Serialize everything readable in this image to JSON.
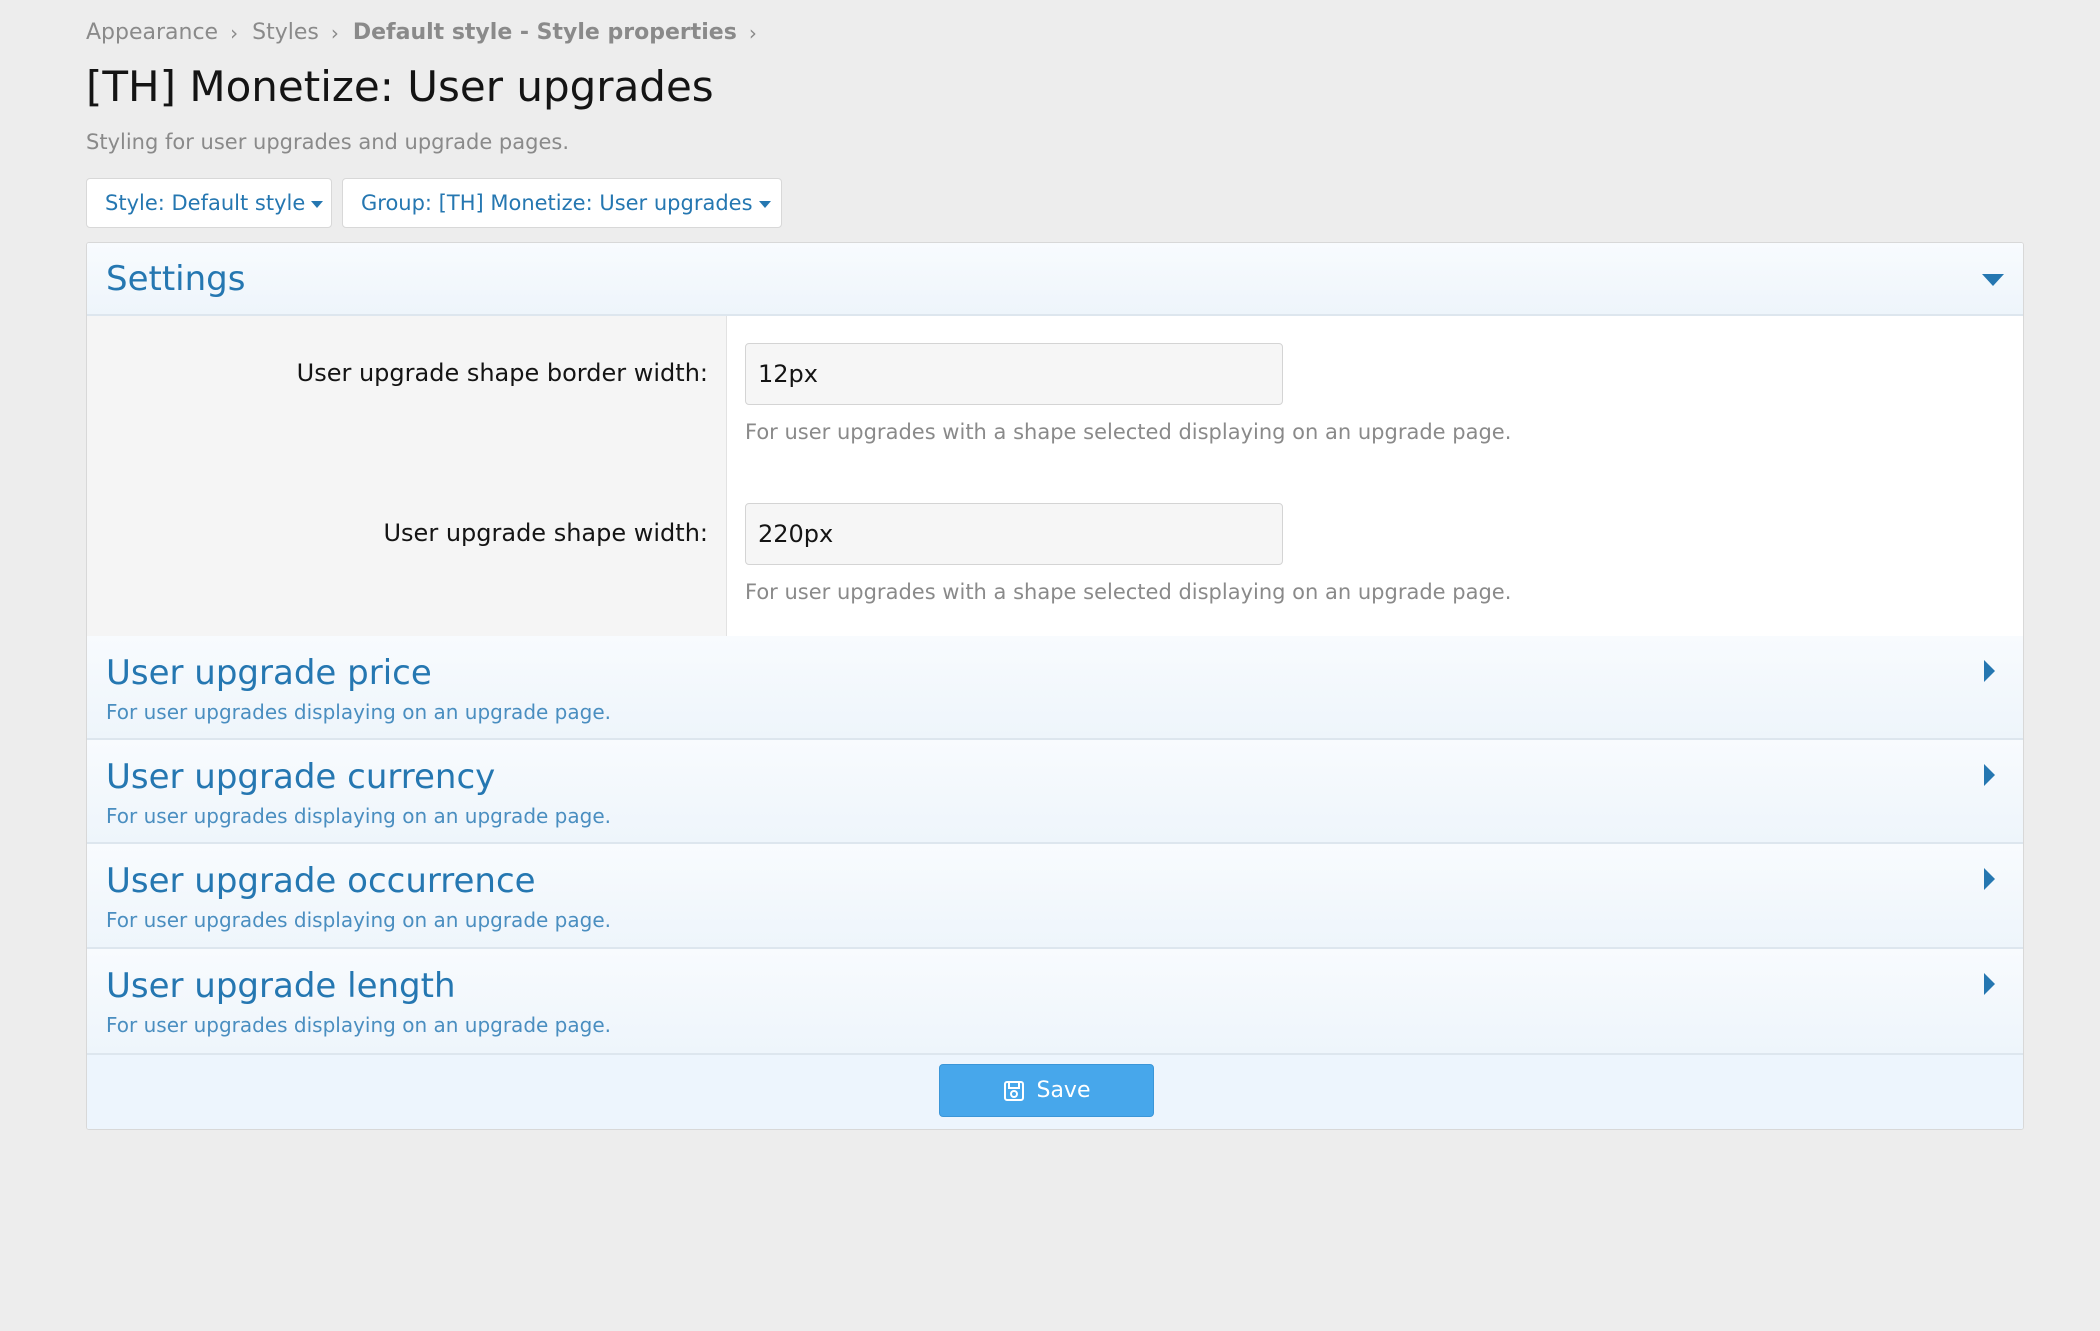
{
  "breadcrumb": {
    "items": [
      "Appearance",
      "Styles",
      "Default style - Style properties"
    ]
  },
  "page": {
    "title": "[TH] Monetize: User upgrades",
    "description": "Styling for user upgrades and upgrade pages."
  },
  "filters": {
    "style_label": "Style: Default style",
    "group_label": "Group: [TH] Monetize: User upgrades"
  },
  "settings": {
    "title": "Settings",
    "rows": [
      {
        "label": "User upgrade shape border width:",
        "value": "12px",
        "help": "For user upgrades with a shape selected displaying on an upgrade page."
      },
      {
        "label": "User upgrade shape width:",
        "value": "220px",
        "help": "For user upgrades with a shape selected displaying on an upgrade page."
      }
    ]
  },
  "groups": [
    {
      "title": "User upgrade price",
      "hint": "For user upgrades displaying on an upgrade page."
    },
    {
      "title": "User upgrade currency",
      "hint": "For user upgrades displaying on an upgrade page."
    },
    {
      "title": "User upgrade occurrence",
      "hint": "For user upgrades displaying on an upgrade page."
    },
    {
      "title": "User upgrade length",
      "hint": "For user upgrades displaying on an upgrade page."
    }
  ],
  "footer": {
    "save_label": "Save"
  },
  "icons": {
    "breadcrumb_separator": "chevron-right-icon",
    "dropdown": "caret-down-icon",
    "expanded": "caret-down-icon",
    "collapsed": "caret-right-icon",
    "save": "floppy-disk-icon"
  },
  "colors": {
    "accent": "#2577b1",
    "save_button": "#47a7eb",
    "background": "#ededed"
  }
}
